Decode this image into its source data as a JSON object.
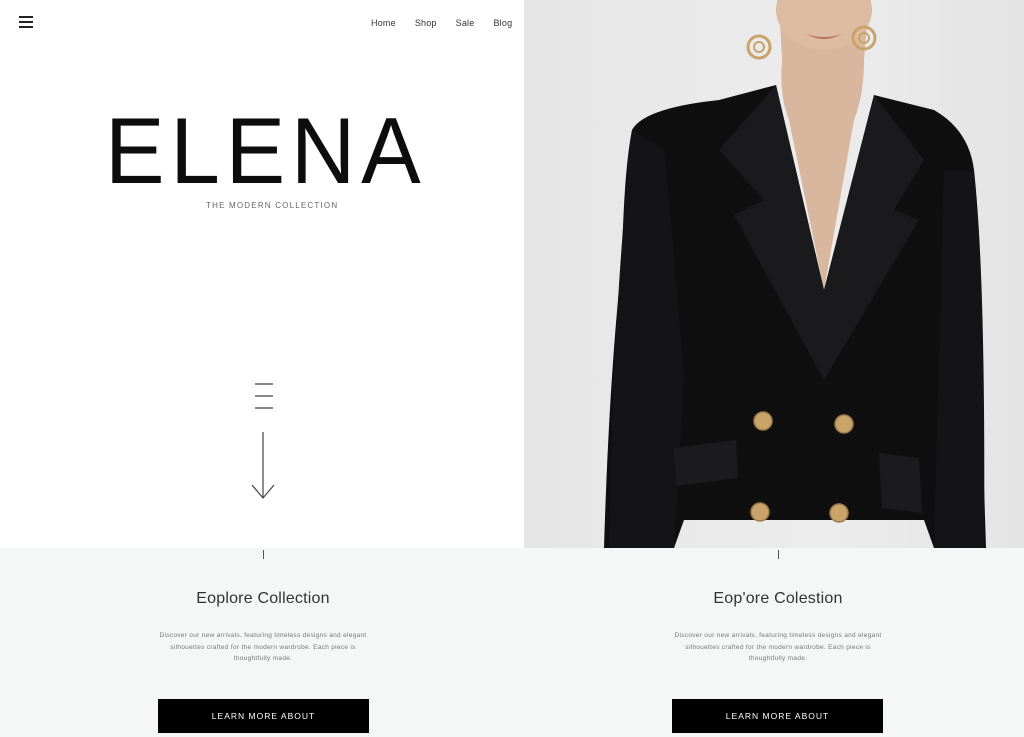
{
  "nav": {
    "items": [
      "Home",
      "Shop",
      "Sale",
      "Blog"
    ]
  },
  "hero": {
    "brand": "ELENA",
    "tagline": "THE MODERN COLLECTION"
  },
  "explore": [
    {
      "title": "Eoplore Collection",
      "description": "Discover our new arrivals, featuring timeless designs and elegant silhouettes crafted for the modern wardrobe. Each piece is thoughtfully made.",
      "cta": "LEARN MORE ABOUT"
    },
    {
      "title": "Eop'ore Colestion",
      "description": "Discover our new arrivals, featuring timeless designs and elegant silhouettes crafted for the modern wardrobe. Each piece is thoughtfully made.",
      "cta": "LEARN MORE ABOUT"
    }
  ],
  "colors": {
    "band": "#f5f6f6",
    "button": "#000000",
    "photo_bg": "#e8e8e8",
    "blazer": "#0f0f10",
    "button_gold": "#c9a46a"
  }
}
